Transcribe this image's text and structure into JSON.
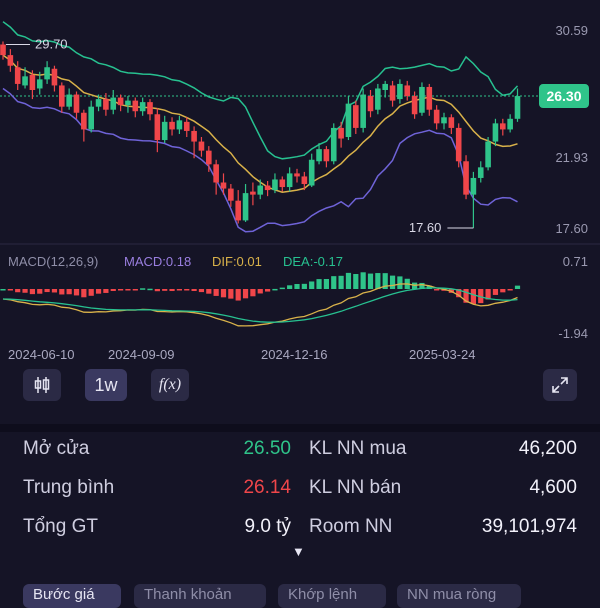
{
  "chart": {
    "price_axis": [
      "30.59",
      "26.30",
      "21.93",
      "17.60"
    ],
    "current_price": "26.30",
    "high_marker": "29.70",
    "low_marker": "17.60",
    "macd_header": {
      "name": "MACD(12,26,9)",
      "macd": "MACD:0.18",
      "dif": "DIF:0.01",
      "dea": "DEA:-0.17"
    },
    "macd_axis": [
      "0.71",
      "-1.94"
    ],
    "dates": [
      "2024-06-10",
      "2024-09-09",
      "2024-12-16",
      "2025-03-24"
    ],
    "colors": {
      "up": "#2fc48a",
      "down": "#f0464a",
      "ma": "#d9b24a",
      "upper_band": "#27c190",
      "lower_band": "#6f63d8",
      "price_line": "#2fc48a"
    }
  },
  "chart_data": {
    "type": "candlestick",
    "note_values": "weekly candles, open/close/high/low",
    "candles": [
      [
        29.7,
        29.0,
        29.9,
        28.7
      ],
      [
        29.0,
        28.3,
        29.4,
        27.9
      ],
      [
        28.2,
        27.1,
        28.6,
        26.7
      ],
      [
        27.0,
        27.6,
        28.2,
        26.8
      ],
      [
        27.7,
        26.7,
        28.0,
        26.1
      ],
      [
        26.8,
        27.4,
        27.9,
        26.4
      ],
      [
        27.4,
        28.2,
        28.6,
        27.1
      ],
      [
        28.1,
        27.0,
        28.3,
        26.6
      ],
      [
        27.0,
        25.6,
        27.2,
        25.2
      ],
      [
        25.6,
        26.4,
        26.8,
        25.4
      ],
      [
        26.4,
        25.2,
        26.6,
        24.8
      ],
      [
        25.2,
        24.1,
        25.4,
        23.3
      ],
      [
        24.1,
        25.6,
        26.0,
        23.9
      ],
      [
        25.6,
        26.1,
        26.4,
        25.3
      ],
      [
        26.1,
        25.4,
        26.5,
        25.0
      ],
      [
        25.4,
        26.2,
        26.7,
        25.1
      ],
      [
        26.2,
        25.7,
        26.4,
        25.3
      ],
      [
        25.7,
        26.0,
        26.3,
        25.2
      ],
      [
        26.0,
        25.3,
        26.2,
        24.9
      ],
      [
        25.3,
        25.9,
        26.2,
        25.0
      ],
      [
        25.9,
        25.1,
        26.1,
        24.7
      ],
      [
        25.1,
        23.4,
        25.5,
        22.6
      ],
      [
        23.4,
        24.6,
        25.0,
        23.2
      ],
      [
        24.6,
        24.1,
        24.9,
        23.7
      ],
      [
        24.1,
        24.7,
        25.0,
        23.8
      ],
      [
        24.6,
        24.0,
        24.9,
        23.6
      ],
      [
        24.0,
        23.3,
        24.3,
        22.2
      ],
      [
        23.3,
        22.7,
        23.6,
        22.3
      ],
      [
        22.7,
        21.8,
        23.0,
        21.3
      ],
      [
        21.8,
        20.6,
        22.1,
        19.8
      ],
      [
        20.6,
        20.2,
        21.2,
        19.8
      ],
      [
        20.2,
        19.4,
        20.5,
        19.0
      ],
      [
        19.4,
        18.1,
        20.1,
        17.9
      ],
      [
        18.1,
        19.9,
        20.5,
        18.0
      ],
      [
        20.0,
        19.8,
        20.6,
        19.1
      ],
      [
        19.8,
        20.4,
        20.8,
        19.5
      ],
      [
        20.4,
        20.1,
        20.7,
        19.7
      ],
      [
        20.1,
        20.8,
        21.2,
        19.9
      ],
      [
        20.8,
        20.3,
        21.0,
        20.0
      ],
      [
        20.3,
        21.2,
        21.6,
        20.0
      ],
      [
        21.2,
        21.0,
        21.5,
        20.6
      ],
      [
        21.0,
        20.5,
        21.3,
        20.1
      ],
      [
        20.4,
        22.1,
        22.5,
        20.3
      ],
      [
        22.0,
        22.8,
        23.2,
        21.8
      ],
      [
        22.8,
        22.0,
        23.0,
        21.6
      ],
      [
        22.0,
        24.2,
        24.5,
        21.8
      ],
      [
        24.2,
        23.5,
        24.6,
        22.9
      ],
      [
        23.6,
        25.8,
        26.3,
        23.4
      ],
      [
        25.7,
        24.2,
        26.0,
        23.8
      ],
      [
        24.2,
        26.4,
        26.8,
        23.9
      ],
      [
        26.3,
        25.3,
        26.7,
        24.9
      ],
      [
        25.4,
        26.8,
        27.1,
        25.1
      ],
      [
        26.7,
        27.1,
        27.3,
        26.2
      ],
      [
        27.0,
        26.0,
        27.3,
        25.6
      ],
      [
        26.1,
        27.1,
        27.4,
        25.8
      ],
      [
        27.0,
        26.3,
        27.3,
        26.0
      ],
      [
        26.3,
        25.1,
        26.6,
        24.8
      ],
      [
        25.2,
        26.9,
        27.2,
        25.0
      ],
      [
        26.9,
        25.4,
        27.1,
        25.0
      ],
      [
        25.4,
        24.5,
        25.7,
        24.1
      ],
      [
        24.5,
        24.9,
        25.2,
        24.1
      ],
      [
        24.9,
        24.2,
        25.1,
        23.8
      ],
      [
        24.2,
        22.0,
        24.5,
        21.6
      ],
      [
        22.0,
        19.8,
        22.4,
        19.5
      ],
      [
        19.8,
        20.9,
        21.3,
        17.6
      ],
      [
        20.9,
        21.6,
        22.0,
        20.6
      ],
      [
        21.6,
        23.3,
        23.6,
        21.4
      ],
      [
        23.3,
        24.5,
        24.8,
        23.0
      ],
      [
        24.5,
        24.1,
        24.8,
        23.7
      ],
      [
        24.1,
        24.8,
        25.1,
        23.9
      ],
      [
        24.8,
        26.3,
        26.8,
        24.6
      ]
    ],
    "ylim": [
      17.6,
      30.59
    ],
    "yticks": [
      30.59,
      26.3,
      21.93,
      17.6
    ],
    "macd_ylim": [
      -1.94,
      0.71
    ]
  },
  "toolbar": {
    "candle_icon": "candlestick-icon",
    "timeframe": "1w",
    "indicator_icon": "f(x)",
    "fullscreen_icon": "expand-icon"
  },
  "stats": {
    "open_label": "Mở cửa",
    "open_value": "26.50",
    "avg_label": "Trung bình",
    "avg_value": "26.14",
    "total_label": "Tổng GT",
    "total_value": "9.0 tỷ",
    "nn_buy_label": "KL NN mua",
    "nn_buy_value": "46,200",
    "nn_sell_label": "KL NN bán",
    "nn_sell_value": "4,600",
    "room_label": "Room NN",
    "room_value": "39,101,974",
    "expand_caret": "▼"
  },
  "tabs": [
    "Bước giá",
    "Thanh khoản",
    "Khớp lệnh",
    "NN mua ròng"
  ]
}
